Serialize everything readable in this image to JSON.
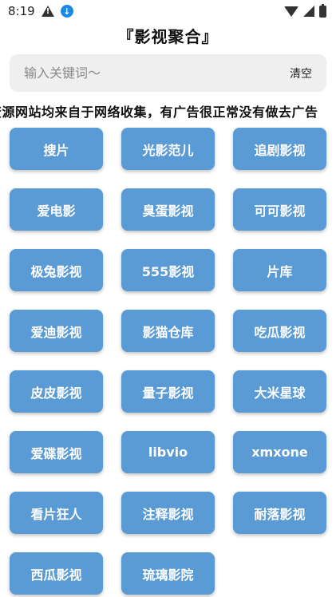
{
  "status_bar": {
    "time": "8:19"
  },
  "header": {
    "title": "『影视聚合』"
  },
  "search": {
    "placeholder": "输入关键词～",
    "value": "",
    "clear_label": "清空"
  },
  "notice": {
    "text": "资源网站均来自于网络收集，有广告很正常没有做去广告"
  },
  "sites": [
    "搜片",
    "光影范儿",
    "追剧影视",
    "爱电影",
    "臭蛋影视",
    "可可影视",
    "极兔影视",
    "555影视",
    "片库",
    "爱迪影视",
    "影猫仓库",
    "吃瓜影视",
    "皮皮影视",
    "量子影视",
    "大米星球",
    "爱碟影视",
    "libvio",
    "xmxone",
    "看片狂人",
    "注释影视",
    "耐落影视",
    "西瓜影视",
    "琉璃影院"
  ],
  "colors": {
    "button_bg": "#5b9bd5",
    "button_text": "#ffffff",
    "search_bg": "#efefef"
  }
}
